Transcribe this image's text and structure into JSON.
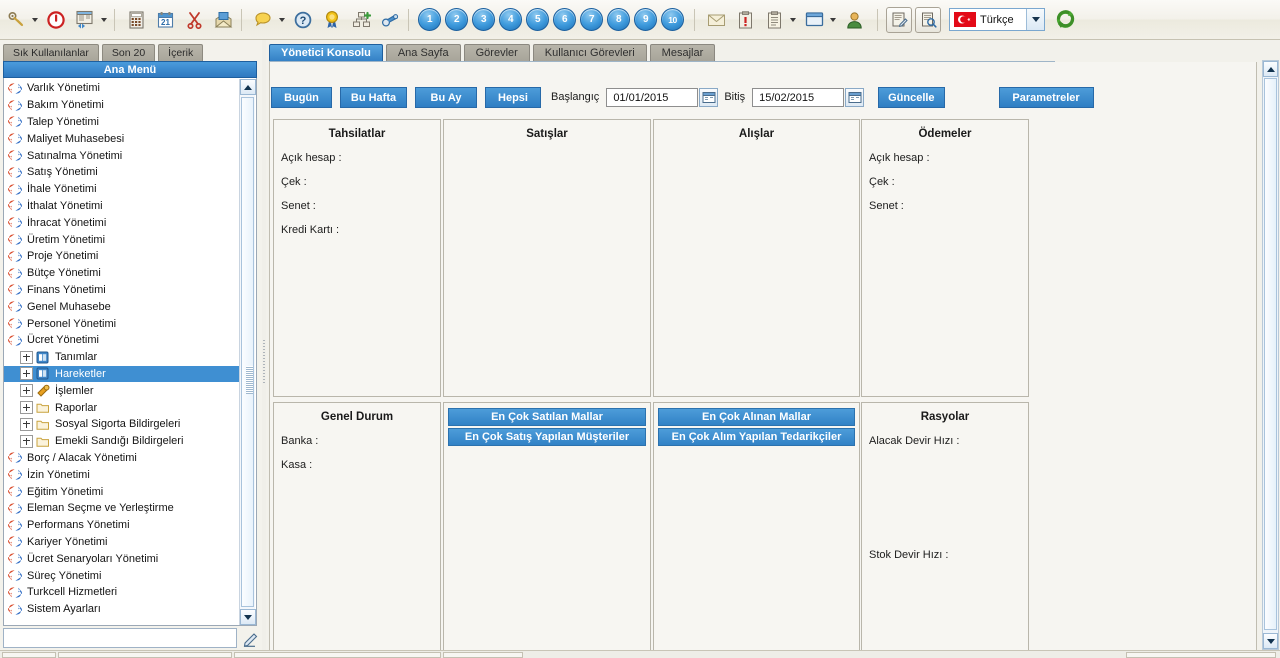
{
  "toolbar": {
    "icons": [
      {
        "name": "keys-icon",
        "caret": true
      },
      {
        "name": "power-off-icon",
        "caret": false
      },
      {
        "name": "window-switch-icon",
        "caret": true
      },
      {
        "name": "calculator-icon",
        "caret": false
      },
      {
        "name": "calendar-icon",
        "caret": false
      },
      {
        "name": "scissors-icon",
        "caret": false
      },
      {
        "name": "mail-open-icon",
        "caret": false
      },
      {
        "name": "note-icon",
        "caret": true
      },
      {
        "name": "help-icon",
        "caret": false
      },
      {
        "name": "award-icon",
        "caret": false
      },
      {
        "name": "sitemap-add-icon",
        "caret": false
      },
      {
        "name": "binoculars-icon",
        "caret": false
      }
    ],
    "numbers": [
      "1",
      "2",
      "3",
      "4",
      "5",
      "6",
      "7",
      "8",
      "9",
      "10"
    ],
    "right_icons": [
      {
        "name": "envelope-icon",
        "caret": false
      },
      {
        "name": "clipboard-alert-icon",
        "caret": false
      },
      {
        "name": "clipboard-list-icon",
        "caret": true
      },
      {
        "name": "window-icon",
        "caret": true
      },
      {
        "name": "user-icon",
        "caret": false
      },
      {
        "name": "edit-document-icon",
        "caret": false
      },
      {
        "name": "preview-document-icon",
        "caret": false
      }
    ],
    "language": "Türkçe",
    "refresh_icon": "refresh-icon"
  },
  "sidebar": {
    "tabs": [
      "Sık Kullanılanlar",
      "Son 20",
      "İçerik"
    ],
    "header": "Ana Menü",
    "items": [
      {
        "label": "Varlık Yönetimi",
        "type": "module"
      },
      {
        "label": "Bakım Yönetimi",
        "type": "module"
      },
      {
        "label": "Talep Yönetimi",
        "type": "module"
      },
      {
        "label": "Maliyet Muhasebesi",
        "type": "module"
      },
      {
        "label": "Satınalma Yönetimi",
        "type": "module"
      },
      {
        "label": "Satış Yönetimi",
        "type": "module"
      },
      {
        "label": "İhale Yönetimi",
        "type": "module"
      },
      {
        "label": "İthalat Yönetimi",
        "type": "module"
      },
      {
        "label": "İhracat Yönetimi",
        "type": "module"
      },
      {
        "label": "Üretim Yönetimi",
        "type": "module"
      },
      {
        "label": "Proje Yönetimi",
        "type": "module"
      },
      {
        "label": "Bütçe Yönetimi",
        "type": "module"
      },
      {
        "label": "Finans Yönetimi",
        "type": "module"
      },
      {
        "label": "Genel Muhasebe",
        "type": "module"
      },
      {
        "label": "Personel Yönetimi",
        "type": "module"
      },
      {
        "label": "Ücret Yönetimi",
        "type": "module"
      },
      {
        "label": "Tanımlar",
        "type": "child-book"
      },
      {
        "label": "Hareketler",
        "type": "child-book",
        "selected": true
      },
      {
        "label": "İşlemler",
        "type": "child-gear"
      },
      {
        "label": "Raporlar",
        "type": "child-folder"
      },
      {
        "label": "Sosyal Sigorta Bildirgeleri",
        "type": "child-folder"
      },
      {
        "label": "Emekli Sandığı Bildirgeleri",
        "type": "child-folder"
      },
      {
        "label": "Borç / Alacak Yönetimi",
        "type": "module"
      },
      {
        "label": "İzin Yönetimi",
        "type": "module"
      },
      {
        "label": "Eğitim Yönetimi",
        "type": "module"
      },
      {
        "label": "Eleman Seçme ve Yerleştirme",
        "type": "module"
      },
      {
        "label": "Performans Yönetimi",
        "type": "module"
      },
      {
        "label": "Kariyer Yönetimi",
        "type": "module"
      },
      {
        "label": "Ücret Senaryoları Yönetimi",
        "type": "module"
      },
      {
        "label": "Süreç Yönetimi",
        "type": "module"
      },
      {
        "label": "Turkcell Hizmetleri",
        "type": "module"
      },
      {
        "label": "Sistem Ayarları",
        "type": "module"
      }
    ],
    "search_value": "",
    "search_placeholder": "",
    "pen_icon": "pen-edit-icon"
  },
  "main": {
    "tabs": [
      {
        "label": "Yönetici Konsolu",
        "active": true
      },
      {
        "label": "Ana Sayfa",
        "active": false
      },
      {
        "label": "Görevler",
        "active": false
      },
      {
        "label": "Kullanıcı Görevleri",
        "active": false
      },
      {
        "label": "Mesajlar",
        "active": false
      }
    ],
    "filters": {
      "quick_buttons": [
        "Bugün",
        "Bu Hafta",
        "Bu Ay",
        "Hepsi"
      ],
      "start_label": "Başlangıç",
      "start_value": "01/01/2015",
      "end_label": "Bitiş",
      "end_value": "15/02/2015",
      "update_button": "Güncelle",
      "parameters_button": "Parametreler",
      "calendar_icon": "calendar-picker-icon"
    },
    "cards": [
      {
        "title": "Tahsilatlar",
        "rows": [
          "Açık hesap :",
          "Çek :",
          "Senet :",
          "Kredi Kartı :"
        ],
        "buttons": []
      },
      {
        "title": "Satışlar",
        "rows": [],
        "buttons": []
      },
      {
        "title": "Alışlar",
        "rows": [],
        "buttons": []
      },
      {
        "title": "Ödemeler",
        "rows": [
          "Açık hesap :",
          "Çek :",
          "Senet :"
        ],
        "buttons": []
      },
      {
        "title": "Genel Durum",
        "rows": [
          "Banka :",
          "Kasa :"
        ],
        "buttons": []
      },
      {
        "title": "",
        "rows": [],
        "buttons": [
          "En Çok Satılan Mallar",
          "En Çok Satış Yapılan Müşteriler"
        ]
      },
      {
        "title": "",
        "rows": [],
        "buttons": [
          "En Çok Alınan Mallar",
          "En Çok Alım Yapılan Tedarikçiler"
        ]
      },
      {
        "title": "Rasyolar",
        "rows": [
          "Alacak Devir Hızı :",
          "Stok Devir Hızı :"
        ],
        "buttons": []
      }
    ]
  },
  "colors": {
    "accent_blue": "#3f8fd2",
    "tab_gray": "#a5a298",
    "panel_bg": "#f6f5f1",
    "selected_row": "#3f8fd2"
  }
}
